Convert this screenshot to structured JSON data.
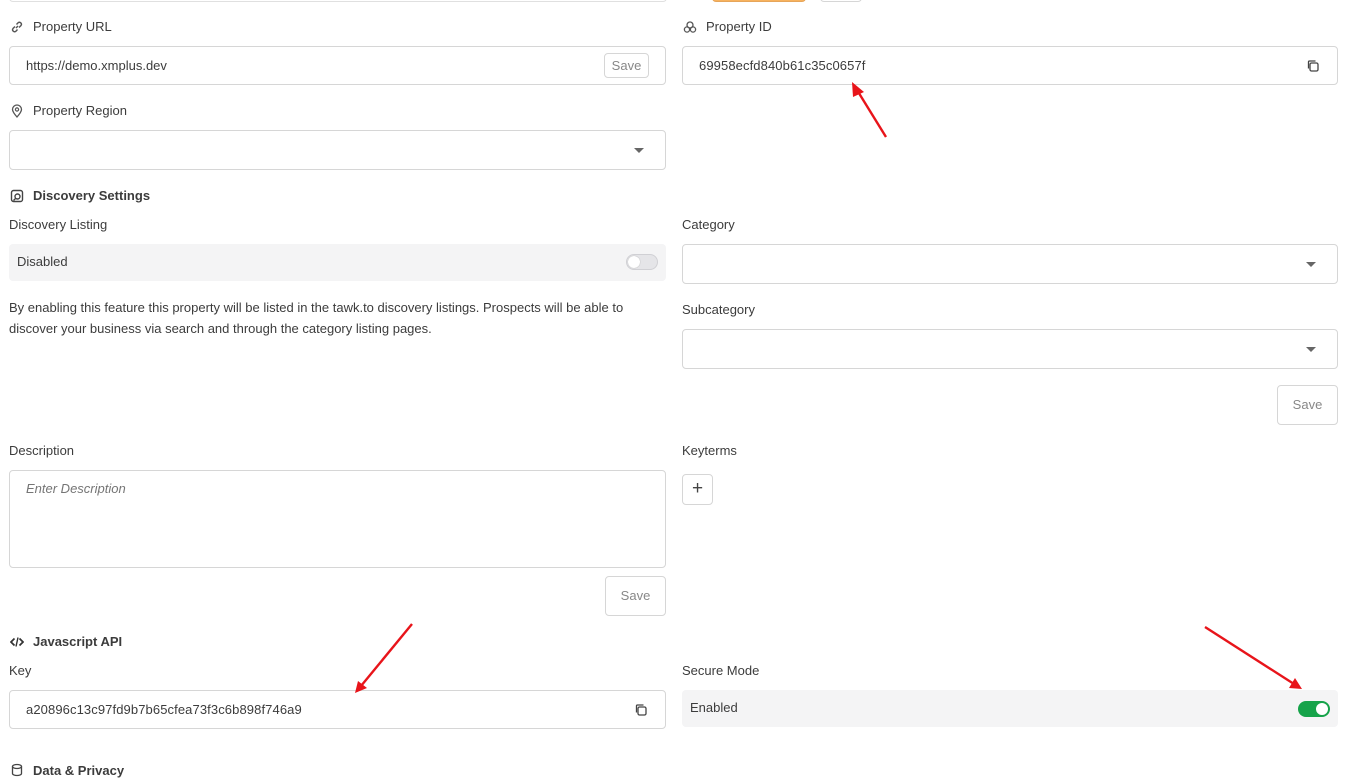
{
  "property_url": {
    "label": "Property URL",
    "value": "https://demo.xmplus.dev",
    "save_label": "Save",
    "icon": "link-icon"
  },
  "property_id": {
    "label": "Property ID",
    "value": "69958ecfd840b61c35c0657f",
    "icon": "id-icon",
    "copy_icon": "copy-icon"
  },
  "property_region": {
    "label": "Property Region",
    "value": "",
    "icon": "location-pin-icon"
  },
  "discovery": {
    "section_title": "Discovery Settings",
    "section_icon": "discovery-icon",
    "listing_label": "Discovery Listing",
    "listing_status": "Disabled",
    "listing_enabled": false,
    "description_text": "By enabling this feature this property will be listed in the tawk.to discovery listings. Prospects will be able to discover your business via search and through the category listing pages.",
    "category_label": "Category",
    "category_value": "",
    "subcategory_label": "Subcategory",
    "subcategory_value": "",
    "save_label": "Save",
    "description_label": "Description",
    "description_placeholder": "Enter Description",
    "description_save_label": "Save",
    "keyterms_label": "Keyterms",
    "add_keyterm_symbol": "+"
  },
  "javascript_api": {
    "section_title": "Javascript API",
    "section_icon": "code-icon",
    "key_label": "Key",
    "key_value": "a20896c13c97fd9b7b65cfea73f3c6b898f746a9",
    "secure_mode_label": "Secure Mode",
    "secure_mode_status": "Enabled",
    "secure_mode_enabled": true
  },
  "data_privacy": {
    "section_title": "Data & Privacy",
    "section_icon": "database-icon"
  },
  "colors": {
    "accent_green": "#16a34a",
    "annotation_red": "#e8141a",
    "top_orange": "#f0a04b"
  }
}
